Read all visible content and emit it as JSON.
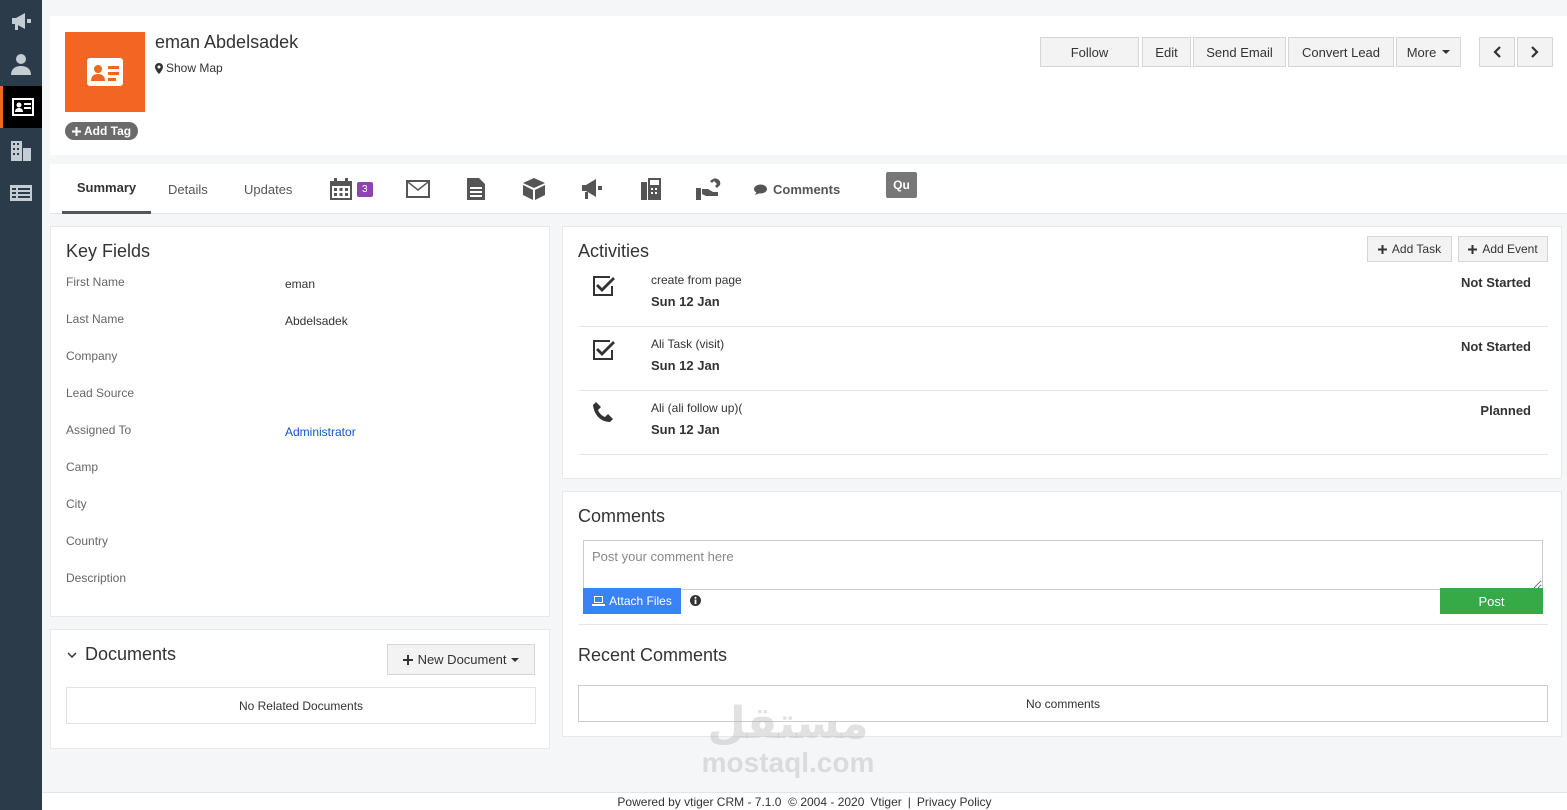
{
  "header": {
    "name": "eman Abdelsadek",
    "show_map": "Show Map",
    "add_tag": "Add Tag",
    "buttons": {
      "follow": "Follow",
      "edit": "Edit",
      "send_email": "Send Email",
      "convert_lead": "Convert Lead",
      "more": "More"
    }
  },
  "tabs": {
    "summary": "Summary",
    "details": "Details",
    "updates": "Updates",
    "calendar_badge": "3",
    "comments": "Comments",
    "qu": "Qu"
  },
  "key_fields": {
    "title": "Key Fields",
    "rows": [
      {
        "label": "First Name",
        "value": "eman"
      },
      {
        "label": "Last Name",
        "value": "Abdelsadek"
      },
      {
        "label": "Company",
        "value": ""
      },
      {
        "label": "Lead Source",
        "value": ""
      },
      {
        "label": "Assigned To",
        "value": "Administrator"
      },
      {
        "label": "Camp",
        "value": ""
      },
      {
        "label": "City",
        "value": ""
      },
      {
        "label": "Country",
        "value": ""
      },
      {
        "label": "Description",
        "value": ""
      }
    ]
  },
  "documents": {
    "title": "Documents",
    "new_document": "New Document",
    "empty": "No Related Documents"
  },
  "activities": {
    "title": "Activities",
    "add_task": "Add Task",
    "add_event": "Add Event",
    "items": [
      {
        "title": "create from page",
        "date": "Sun 12 Jan",
        "status": "Not Started",
        "icon": "task-check-icon"
      },
      {
        "title": "Ali Task (visit)",
        "date": "Sun 12 Jan",
        "status": "Not Started",
        "icon": "task-check-icon"
      },
      {
        "title": "Ali (ali follow up)(",
        "date": "Sun 12 Jan",
        "status": "Planned",
        "icon": "phone-icon"
      }
    ]
  },
  "comments": {
    "title": "Comments",
    "placeholder": "Post your comment here",
    "attach_files": "Attach Files",
    "post": "Post",
    "recent_title": "Recent Comments",
    "empty": "No comments"
  },
  "footer": {
    "powered": "Powered by vtiger CRM - 7.1.0  © 2004 - 2020",
    "vtiger": "Vtiger",
    "sep": "|",
    "privacy": "Privacy Policy"
  },
  "watermark": {
    "arabic": "مستقل",
    "latin": "mostaql.com"
  },
  "colors": {
    "accent": "#f26522",
    "rail": "#2c3b49",
    "primary_button": "#3b82f6",
    "post_button": "#35aa47",
    "badge": "#8e44ad",
    "link": "#1155cc"
  }
}
